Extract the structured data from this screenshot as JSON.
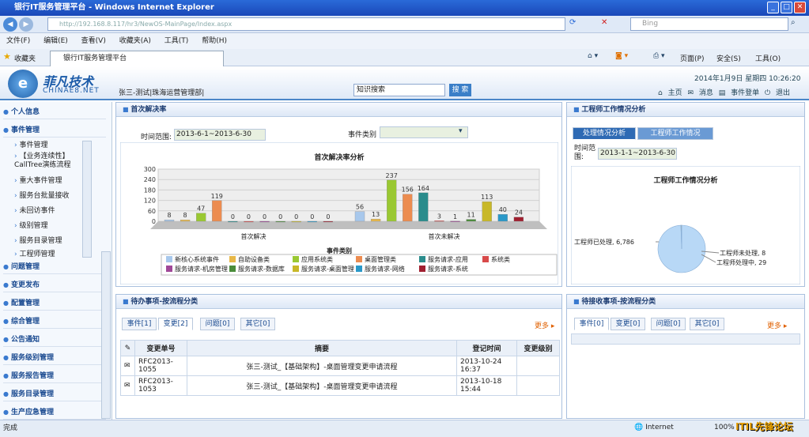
{
  "window": {
    "title": "银行IT服务管理平台 - Windows Internet Explorer"
  },
  "browser": {
    "url": "http://192.168.8.117/hr3/NewOS-MainPage/Index.aspx",
    "search_placeholder": "Bing",
    "menu": [
      "文件(F)",
      "编辑(E)",
      "查看(V)",
      "收藏夹(A)",
      "工具(T)",
      "帮助(H)"
    ],
    "favorites_label": "收藏夹",
    "tab_title": "银行IT服务管理平台",
    "cmd": {
      "page": "页面(P)",
      "safety": "安全(S)",
      "tools": "工具(O)"
    }
  },
  "header": {
    "logo_cn": "菲凡技术",
    "logo_en": "CHINAE8.NET",
    "logo_mark": "e",
    "user": "张三-测试|珠海运营管理部|",
    "search_value": "知识搜索",
    "search_button": "搜 索",
    "date": "2014年1月9日  星期四  10:26:20",
    "links": [
      "主页",
      "消息",
      "事件登单",
      "退出"
    ]
  },
  "sidebar": {
    "sections_top": [
      "个人信息",
      "事件管理"
    ],
    "sub_items": [
      "事件管理",
      "【业务连续性】CallTree演练流程",
      "重大事件管理",
      "服务台批量接收",
      "未回访事件",
      "级别管理",
      "服务目录管理",
      "工程师管理"
    ],
    "sections": [
      "问题管理",
      "变更发布",
      "配置管理",
      "综合管理",
      "公告通知",
      "服务级别管理",
      "服务报告管理",
      "服务目录管理",
      "生产应急管理"
    ]
  },
  "panel_fcr": {
    "title": "首次解决率",
    "time_label": "时间范围:",
    "time_value": "2013-6-1~2013-6-30",
    "type_label": "事件类别"
  },
  "panel_eng": {
    "title": "工程师工作情况分析",
    "tabs": [
      "处理情况分析",
      "工程师工作情况"
    ],
    "time_label": "时间范围:",
    "time_value": "2013-1-1~2013-6-30"
  },
  "panel_todo": {
    "title": "待办事项-按流程分类",
    "tabs": [
      "事件[1]",
      "变更[2]",
      "问题[0]",
      "其它[0]"
    ],
    "more": "更多",
    "columns": [
      "变更单号",
      "摘要",
      "登记时间",
      "变更级别"
    ],
    "rows": [
      {
        "id": "RFC2013-1055",
        "summary": "张三-测试_【基础架构】-桌面管理变更申请流程",
        "time": "2013-10-24 16:37",
        "level": ""
      },
      {
        "id": "RFC2013-1053",
        "summary": "张三-测试_【基础架构】-桌面管理变更申请流程",
        "time": "2013-10-18 15:44",
        "level": ""
      }
    ]
  },
  "panel_recv": {
    "title": "待接收事项-按流程分类",
    "tabs": [
      "事件[0]",
      "变更[0]",
      "问题[0]",
      "其它[0]"
    ],
    "more": "更多"
  },
  "status": {
    "left": "完成",
    "zone": "Internet",
    "zoom": "100%",
    "watermark": "ITIL先锋论坛"
  },
  "chart_data": [
    {
      "type": "bar",
      "title": "首次解决率分析",
      "xlabel": "事件类别",
      "ylim": [
        0,
        300
      ],
      "yticks": [
        0,
        60,
        120,
        180,
        240,
        300
      ],
      "categories": [
        "首次解决",
        "首次未解决"
      ],
      "series": [
        {
          "name": "新核心系统事件",
          "color": "#a8c8ec",
          "values": [
            8,
            56
          ]
        },
        {
          "name": "自助设备类",
          "color": "#e8b848",
          "values": [
            8,
            13
          ]
        },
        {
          "name": "应用系统类",
          "color": "#9ac832",
          "values": [
            47,
            237
          ]
        },
        {
          "name": "桌面管理类",
          "color": "#ec8c50",
          "values": [
            119,
            156
          ]
        },
        {
          "name": "服务请求-应用",
          "color": "#2a8c8c",
          "values": [
            0,
            164
          ]
        },
        {
          "name": "系统类",
          "color": "#d84a4a",
          "values": [
            0,
            3
          ]
        },
        {
          "name": "服务请求-机房管理",
          "color": "#a04898",
          "values": [
            0,
            1
          ]
        },
        {
          "name": "服务请求-数据库",
          "color": "#4a8c3a",
          "values": [
            0,
            11
          ]
        },
        {
          "name": "服务请求-桌面管理",
          "color": "#c8b828",
          "values": [
            0,
            113
          ]
        },
        {
          "name": "服务请求-网络",
          "color": "#2a98c8",
          "values": [
            0,
            40
          ]
        },
        {
          "name": "服务请求-系统",
          "color": "#a02030",
          "values": [
            0,
            24
          ]
        }
      ]
    },
    {
      "type": "pie",
      "title": "工程师工作情况分析",
      "slices": [
        {
          "label": "工程师已处理",
          "value": 6786,
          "color": "#b8d8f6"
        },
        {
          "label": "工程师未处理",
          "value": 8,
          "color": "#3a78c8"
        },
        {
          "label": "工程师处理中",
          "value": 29,
          "color": "#e8b848"
        }
      ]
    }
  ]
}
